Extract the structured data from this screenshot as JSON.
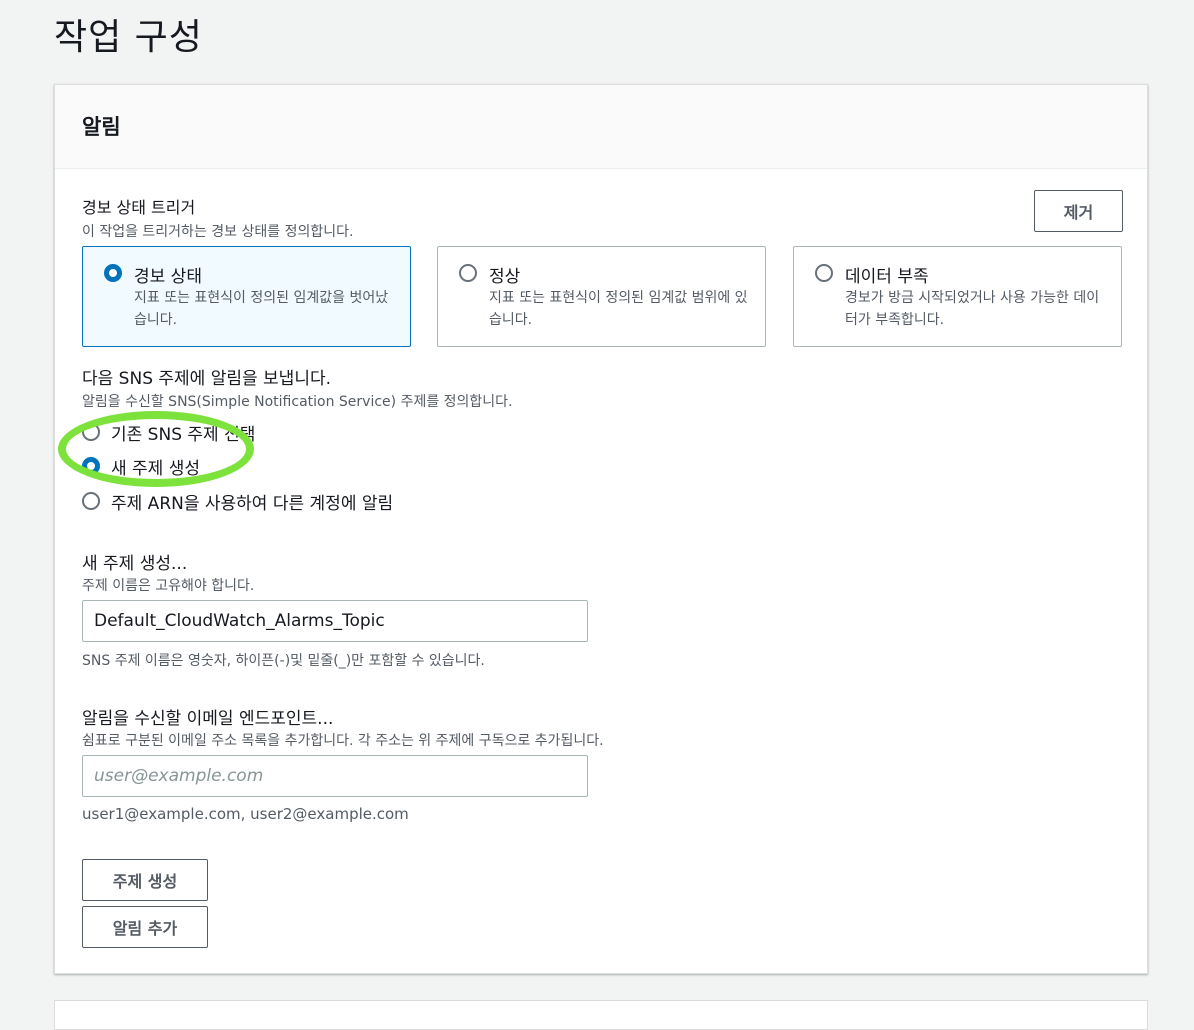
{
  "page": {
    "title": "작업 구성"
  },
  "notification": {
    "header": "알림",
    "trigger": {
      "label": "경보 상태 트리거",
      "description": "이 작업을 트리거하는 경보 상태를 정의합니다.",
      "remove_label": "제거",
      "options": [
        {
          "title": "경보 상태",
          "description": "지표 또는 표현식이 정의된 임계값을 벗어났습니다.",
          "selected": true
        },
        {
          "title": "정상",
          "description": "지표 또는 표현식이 정의된 임계값 범위에 있습니다.",
          "selected": false
        },
        {
          "title": "데이터 부족",
          "description": "경보가 방금 시작되었거나 사용 가능한 데이터가 부족합니다.",
          "selected": false
        }
      ]
    },
    "sns": {
      "label": "다음 SNS 주제에 알림을 보냅니다.",
      "description": "알림을 수신할 SNS(Simple Notification Service) 주제를 정의합니다.",
      "options": [
        {
          "label": "기존 SNS 주제 선택",
          "selected": false
        },
        {
          "label": "새 주제 생성",
          "selected": true
        },
        {
          "label": "주제 ARN을 사용하여 다른 계정에 알림",
          "selected": false
        }
      ]
    },
    "new_topic": {
      "label": "새 주제 생성...",
      "description": "주제 이름은 고유해야 합니다.",
      "value": "Default_CloudWatch_Alarms_Topic",
      "constraint": "SNS 주제 이름은 영숫자, 하이픈(-)및 밑줄(_)만 포함할 수 있습니다."
    },
    "email": {
      "label": "알림을 수신할 이메일 엔드포인트...",
      "description": "쉼표로 구분된 이메일 주소 목록을 추가합니다. 각 주소는 위 주제에 구독으로 추가됩니다.",
      "placeholder": "user@example.com",
      "hint": "user1@example.com, user2@example.com"
    },
    "create_topic_label": "주제 생성",
    "add_notification_label": "알림 추가"
  },
  "colors": {
    "accent": "#0073bb",
    "highlight": "#7ee23d",
    "background": "#f2f3f3"
  }
}
